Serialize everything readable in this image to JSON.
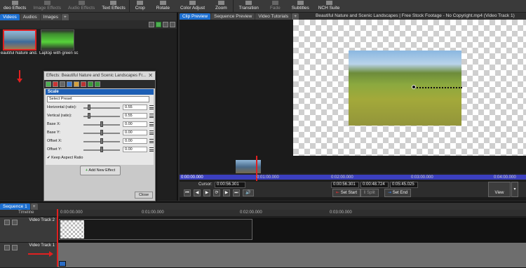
{
  "toolbar": {
    "items": [
      {
        "label": "deo Effects",
        "icon": "effects-icon",
        "dim": false
      },
      {
        "label": "Image Effects",
        "icon": "image-effects-icon",
        "dim": true
      },
      {
        "label": "Audio Effects",
        "icon": "audio-effects-icon",
        "dim": true
      },
      {
        "label": "Text Effects",
        "icon": "text-effects-icon",
        "dim": false
      },
      {
        "label": "Crop",
        "icon": "crop-icon",
        "dim": false
      },
      {
        "label": "Rotate",
        "icon": "rotate-icon",
        "dim": false
      },
      {
        "label": "Color Adjust",
        "icon": "color-adjust-icon",
        "dim": false
      },
      {
        "label": "Zoom",
        "icon": "zoom-icon",
        "dim": false
      },
      {
        "label": "Transition",
        "icon": "transition-icon",
        "dim": false
      },
      {
        "label": "Fade",
        "icon": "fade-icon",
        "dim": true
      },
      {
        "label": "Subtitles",
        "icon": "subtitles-icon",
        "dim": false
      },
      {
        "label": "NCH Suite",
        "icon": "nch-suite-icon",
        "dim": false
      }
    ]
  },
  "bin": {
    "tabs": [
      "Videos",
      "Audios",
      "Images",
      "+"
    ],
    "active_tab": "Videos",
    "clips": [
      {
        "label": "eautiful Nature and...",
        "selected": true
      },
      {
        "label": "Laptop with green sc...",
        "selected": false
      }
    ]
  },
  "effects_dialog": {
    "title": "Effects: Beautiful Nature and Scenic Landscapes",
    "title_suffix": "Fr...",
    "close": "✕",
    "section": "Scale",
    "preset": "Select Preset",
    "params": [
      {
        "label": "Horizontal (ratio):",
        "value": "0.55"
      },
      {
        "label": "Vertical (ratio):",
        "value": "0.55"
      },
      {
        "label": "Base X:",
        "value": "0.00"
      },
      {
        "label": "Base Y:",
        "value": "0.00"
      },
      {
        "label": "Offset X:",
        "value": "0.00"
      },
      {
        "label": "Offset Y:",
        "value": "0.00"
      }
    ],
    "keep_aspect": "Keep Aspect Ratio",
    "keep_aspect_checked": true,
    "add_new_effect": "Add New Effect",
    "close_button": "Close"
  },
  "preview": {
    "tabs": [
      "Clip Preview",
      "Sequence Preview",
      "Video Tutorials",
      "+"
    ],
    "active_tab": "Clip Preview",
    "title": "Beautiful Nature and Scenic Landscapes  |  Free Stock Footage - No Copyright.mp4 (Video Track 1)",
    "timeline_labels": [
      "0:00:00.000",
      "0:01:00.000",
      "0:02:00.000",
      "0:03:00.000",
      "0:04:00.000"
    ],
    "cursor_label": "Cursor:",
    "cursor_value": "0:00:56.301",
    "start_value": "0:00:56.301",
    "duration_value": "0:00:48.724",
    "end_value": "0:05:45.025",
    "set_start": "Set Start",
    "split": "Split",
    "set_end": "Set End",
    "view": "View"
  },
  "sequence": {
    "tabs": [
      "Sequence 1",
      "+"
    ],
    "timeline_label": "Timeline",
    "ruler_labels": [
      "0:00:00.000",
      "0:01:00.000",
      "0:02:00.000",
      "0:03:00.000"
    ],
    "tracks": [
      "Video Track 2",
      "Video Track 1"
    ]
  },
  "colors": {
    "accent_blue": "#1d6fd0",
    "playhead_red": "#e02020",
    "panel_dark": "#1f1f1f"
  }
}
